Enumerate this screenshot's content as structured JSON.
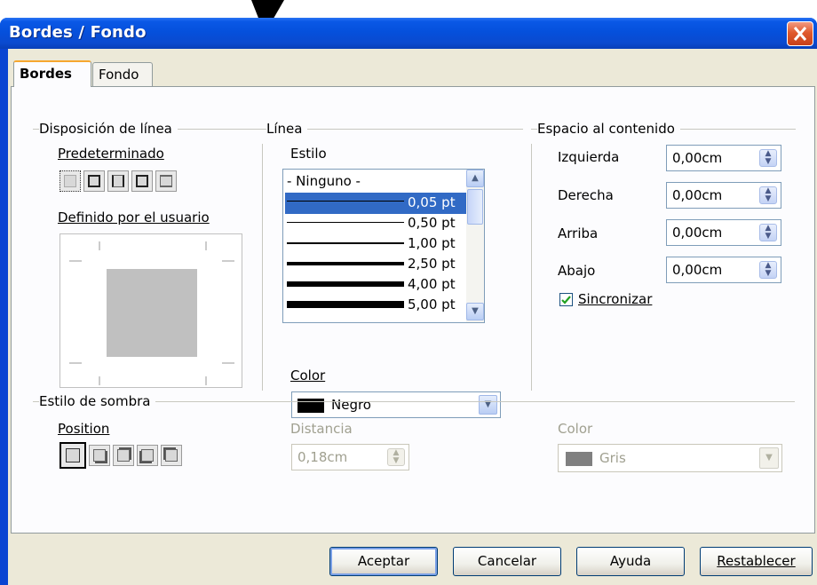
{
  "window": {
    "title": "Bordes / Fondo"
  },
  "tabs": [
    {
      "label": "Bordes",
      "active": true
    },
    {
      "label": "Fondo",
      "active": false
    }
  ],
  "disposicion": {
    "title": "Disposición de línea",
    "predeterminado_label": "Predeterminado",
    "definido_label": "Definido por el usuario"
  },
  "linea": {
    "title": "Línea",
    "estilo_label": "Estilo",
    "styles": [
      {
        "label": "- Ninguno -"
      },
      {
        "label": "0,05 pt"
      },
      {
        "label": "0,50 pt"
      },
      {
        "label": "1,00 pt"
      },
      {
        "label": "2,50 pt"
      },
      {
        "label": "4,00 pt"
      },
      {
        "label": "5,00 pt"
      }
    ],
    "selected_style": "0,05 pt",
    "color_label": "Color",
    "color_value": "Negro",
    "color_swatch": "#000000"
  },
  "espacio": {
    "title": "Espacio al contenido",
    "izquierda_label": "Izquierda",
    "izquierda_value": "0,00cm",
    "derecha_label": "Derecha",
    "derecha_value": "0,00cm",
    "arriba_label": "Arriba",
    "arriba_value": "0,00cm",
    "abajo_label": "Abajo",
    "abajo_value": "0,00cm",
    "sincronizar_label": "Sincronizar",
    "sincronizar_checked": true
  },
  "sombra": {
    "title": "Estilo de sombra",
    "position_label": "Position",
    "distancia_label": "Distancia",
    "distancia_value": "0,18cm",
    "color_label": "Color",
    "color_value": "Gris",
    "color_swatch": "#808080"
  },
  "buttons": {
    "aceptar": "Aceptar",
    "cancelar": "Cancelar",
    "ayuda": "Ayuda",
    "restablecer": "Restablecer"
  },
  "colors": {
    "title_bar": "#0a58e6",
    "selection": "#316ac5",
    "dialog_bg": "#ece9d8"
  }
}
